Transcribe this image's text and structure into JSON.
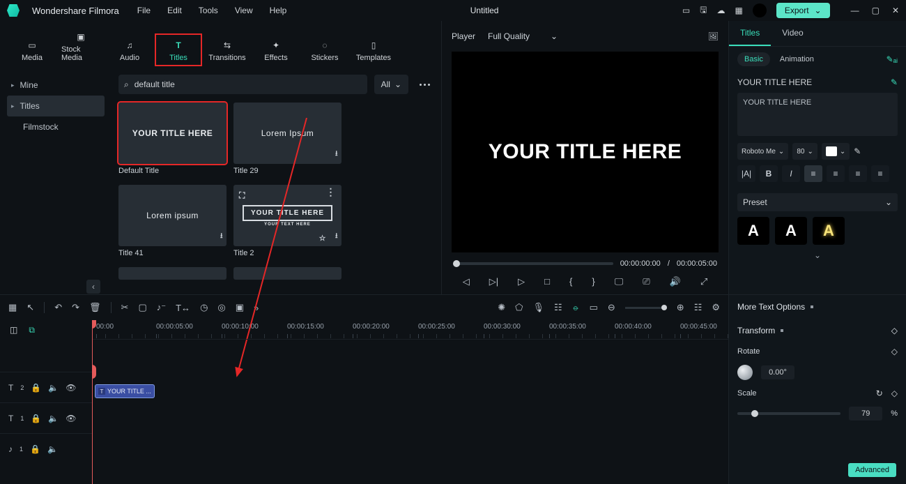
{
  "app": {
    "name": "Wondershare Filmora",
    "doc": "Untitled"
  },
  "menu": [
    "File",
    "Edit",
    "Tools",
    "View",
    "Help"
  ],
  "export_label": "Export",
  "tabs": [
    {
      "label": "Media"
    },
    {
      "label": "Stock Media"
    },
    {
      "label": "Audio"
    },
    {
      "label": "Titles"
    },
    {
      "label": "Transitions"
    },
    {
      "label": "Effects"
    },
    {
      "label": "Stickers"
    },
    {
      "label": "Templates"
    }
  ],
  "sidebar": {
    "items": [
      "Mine",
      "Titles",
      "Filmstock"
    ]
  },
  "search": {
    "value": "default title"
  },
  "filter": {
    "label": "All"
  },
  "cards": [
    {
      "thumb": "YOUR TITLE HERE",
      "caption": "Default Title"
    },
    {
      "thumb": "Lorem Ipsum",
      "caption": "Title 29"
    },
    {
      "thumb": "Lorem ipsum",
      "caption": "Title 41"
    },
    {
      "thumb": "YOUR TITLE HERE",
      "sub": "YOUR TEXT HERE",
      "caption": "Title 2"
    }
  ],
  "preview": {
    "label": "Player",
    "quality": "Full Quality",
    "text": "YOUR TITLE HERE",
    "time_cur": "00:00:00:00",
    "time_sep": "/",
    "time_dur": "00:00:05:00"
  },
  "inspector": {
    "tabs": [
      "Titles",
      "Video"
    ],
    "sub": {
      "basic": "Basic",
      "anim": "Animation"
    },
    "title_label": "YOUR TITLE HERE",
    "textarea": "YOUR TITLE HERE",
    "font": "Roboto Me",
    "size": "80",
    "preset_label": "Preset",
    "more_text": "More Text Options",
    "transform": "Transform",
    "rotate_label": "Rotate",
    "rotate_val": "0.00°",
    "scale_label": "Scale",
    "scale_val": "79",
    "scale_unit": "%",
    "advanced": "Advanced"
  },
  "ruler": [
    "00:00",
    "00:00:05:00",
    "00:00:10:00",
    "00:00:15:00",
    "00:00:20:00",
    "00:00:25:00",
    "00:00:30:00",
    "00:00:35:00",
    "00:00:40:00",
    "00:00:45:00"
  ],
  "tracks": {
    "t2": {
      "icon": "T",
      "num": "2"
    },
    "t1": {
      "icon": "T",
      "num": "1"
    },
    "a1": {
      "icon": "♪",
      "num": "1"
    }
  },
  "clip_label": "YOUR TITLE ..."
}
